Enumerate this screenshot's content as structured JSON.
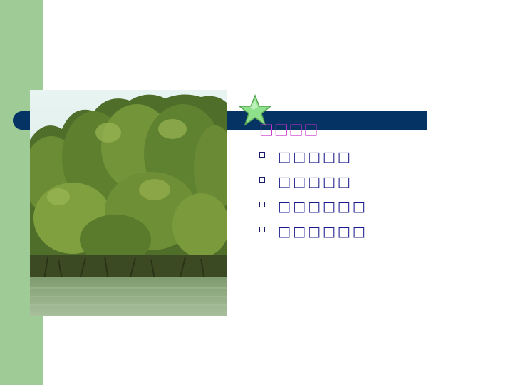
{
  "slide": {
    "heading": "□□□□",
    "bullets": [
      {
        "text": "□□□□□"
      },
      {
        "text": "□□□□□"
      },
      {
        "text": "□□□□□□"
      },
      {
        "text": "□□□□□□"
      }
    ]
  },
  "colors": {
    "left_band": "#9fcb96",
    "title_bar": "#053364",
    "heading": "#cc33cc",
    "bullet_text": "#1a1a8a",
    "star": "#8ee08a"
  },
  "icons": {
    "star": "star-icon",
    "bullet": "square-bullet-icon"
  }
}
